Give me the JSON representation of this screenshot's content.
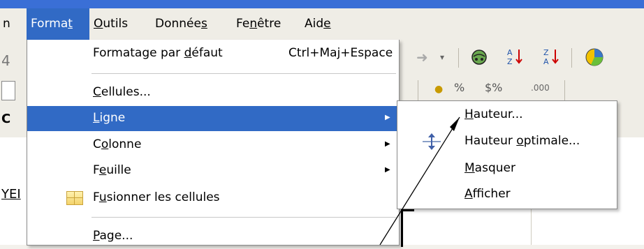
{
  "menubar": {
    "items": [
      {
        "text": "n"
      },
      {
        "text": "Format",
        "active": true,
        "underline_index": 5
      },
      {
        "text": "Outils",
        "underline_index": 0
      },
      {
        "text": "Données",
        "underline_index": 5
      },
      {
        "text": "Fenêtre",
        "underline_index": 2
      },
      {
        "text": "Aide",
        "underline_index": 3
      }
    ]
  },
  "format_menu": {
    "default_format": {
      "pre": "Formatage par ",
      "ul": "d",
      "post": "éfaut",
      "shortcut": "Ctrl+Maj+Espace"
    },
    "cells": {
      "pre": "",
      "ul": "C",
      "post": "ellules..."
    },
    "row": {
      "pre": "",
      "ul": "L",
      "post": "igne"
    },
    "column": {
      "pre": "C",
      "ul": "o",
      "post": "lonne"
    },
    "sheet": {
      "pre": "F",
      "ul": "e",
      "post": "uille"
    },
    "merge": {
      "pre": "F",
      "ul": "u",
      "post": "sionner les cellules"
    },
    "page": {
      "pre": "",
      "ul": "P",
      "post": "age..."
    }
  },
  "row_submenu": {
    "height": {
      "pre": "",
      "ul": "H",
      "post": "auteur..."
    },
    "optimal_height": {
      "pre": "Hauteur ",
      "ul": "o",
      "post": "ptimale..."
    },
    "hide": {
      "pre": "",
      "ul": "M",
      "post": "asquer"
    },
    "show": {
      "pre": "",
      "ul": "A",
      "post": "fficher"
    }
  },
  "toolbar": {
    "snip_1": "4",
    "snip_2": "C",
    "snip_3": "YEI",
    "percent": "%",
    "currency": "$%",
    "decimals": ".000"
  },
  "colors": {
    "highlight": "#316ac5",
    "menu_bg": "#ffffff"
  },
  "icons": [
    "redo-icon",
    "chart-icon",
    "sort-ascending-icon",
    "sort-descending-icon",
    "pie-chart-icon",
    "merge-cells-icon",
    "optimal-row-height-icon",
    "submenu-arrow-icon"
  ]
}
